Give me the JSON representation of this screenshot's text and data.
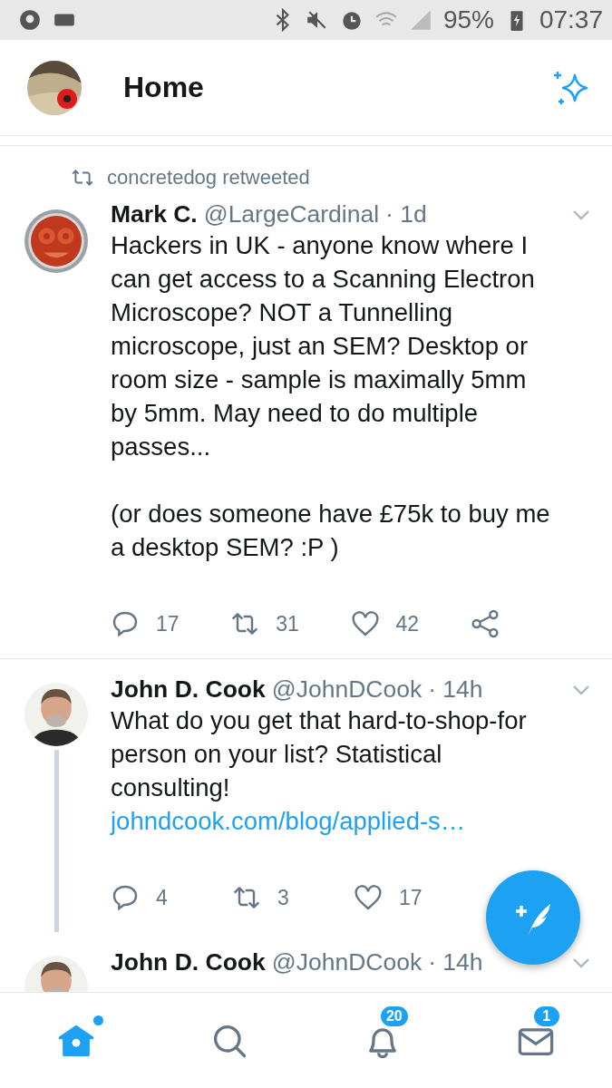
{
  "status_bar": {
    "battery": "95%",
    "time": "07:37"
  },
  "header": {
    "title": "Home"
  },
  "tweets": [
    {
      "retweeted_by": "concretedog retweeted",
      "name": "Mark C.",
      "handle": "@LargeCardinal",
      "time": "· 1d",
      "paragraphs": [
        "Hackers in UK - anyone know where I can get access to a Scanning Electron Microscope? NOT a Tunnelling microscope, just an SEM? Desktop or room size - sample is maximally 5mm by 5mm. May need to do multiple passes...",
        "(or does someone have £75k to buy me a desktop SEM? :P )"
      ],
      "thread": false,
      "actions": [
        {
          "kind": "reply",
          "count": "17"
        },
        {
          "kind": "retweet",
          "count": "31"
        },
        {
          "kind": "like",
          "count": "42"
        },
        {
          "kind": "share"
        }
      ]
    },
    {
      "name": "John D. Cook",
      "handle": "@JohnDCook",
      "time": "· 14h",
      "paragraphs": [
        "What do you get that hard-to-shop-for person on your list? Statistical consulting!"
      ],
      "link": "johndcook.com/blog/applied-s…",
      "thread": true,
      "actions": [
        {
          "kind": "reply",
          "count": "4"
        },
        {
          "kind": "retweet",
          "count": "3"
        },
        {
          "kind": "like",
          "count": "17"
        }
      ]
    },
    {
      "name": "John D. Cook",
      "handle": "@JohnDCook",
      "time": "· 14h",
      "thread": false
    }
  ],
  "nav": [
    {
      "kind": "home",
      "selected": true,
      "unread": true
    },
    {
      "kind": "search",
      "selected": false,
      "unread": false
    },
    {
      "kind": "notifications",
      "selected": false,
      "unread": false,
      "badge": "20"
    },
    {
      "kind": "messages",
      "selected": false,
      "unread": false,
      "badge": "1"
    }
  ]
}
